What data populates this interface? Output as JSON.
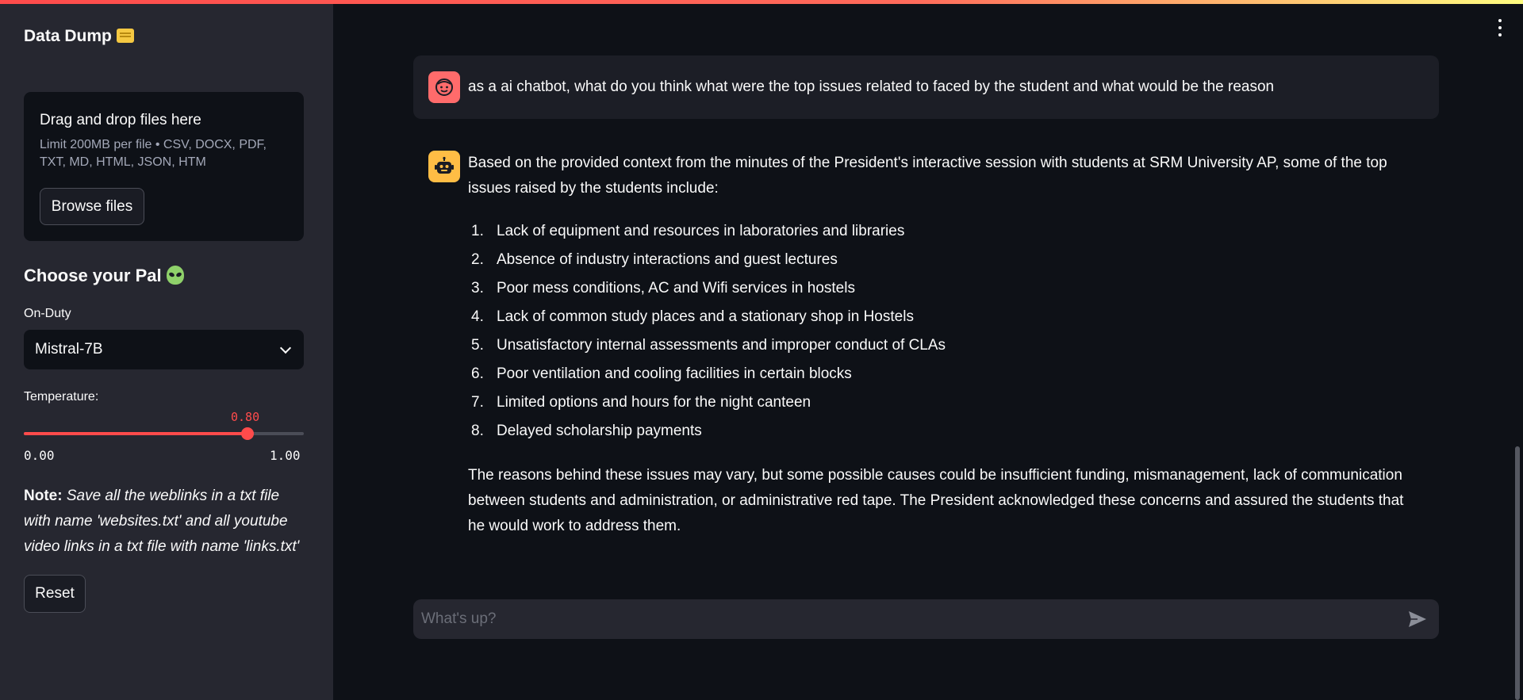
{
  "sidebar": {
    "app_title": "Data Dump",
    "uploader": {
      "title": "Drag and drop files here",
      "limit": "Limit 200MB per file • CSV, DOCX, PDF, TXT, MD, HTML, JSON, HTM",
      "browse_label": "Browse files"
    },
    "pal_title": "Choose your Pal",
    "model_select": {
      "label": "On-Duty",
      "value": "Mistral-7B"
    },
    "temperature": {
      "label": "Temperature:",
      "value": "0.80",
      "level": 0.8,
      "min": "0.00",
      "max": "1.00"
    },
    "note": {
      "label": "Note:",
      "text": "Save all the weblinks in a txt file with name 'websites.txt' and all youtube video links in a txt file with name 'links.txt'"
    },
    "reset_label": "Reset"
  },
  "chat": {
    "user_message": "as a ai chatbot, what do you think what were the top issues related to faced by the student and what would be the reason",
    "assistant": {
      "intro": "Based on the provided context from the minutes of the President's interactive session with students at SRM University AP, some of the top issues raised by the students include:",
      "items": [
        {
          "num": "1.",
          "text": "Lack of equipment and resources in laboratories and libraries"
        },
        {
          "num": "2.",
          "text": "Absence of industry interactions and guest lectures"
        },
        {
          "num": "3.",
          "text": "Poor mess conditions, AC and Wifi services in hostels"
        },
        {
          "num": "4.",
          "text": "Lack of common study places and a stationary shop in Hostels"
        },
        {
          "num": "5.",
          "text": "Unsatisfactory internal assessments and improper conduct of CLAs"
        },
        {
          "num": "6.",
          "text": "Poor ventilation and cooling facilities in certain blocks"
        },
        {
          "num": "7.",
          "text": "Limited options and hours for the night canteen"
        },
        {
          "num": "8.",
          "text": "Delayed scholarship payments"
        }
      ],
      "conclusion": "The reasons behind these issues may vary, but some possible causes could be insufficient funding, mismanagement, lack of communication between students and administration, or administrative red tape. The President acknowledged these concerns and assured the students that he would work to address them."
    },
    "input_placeholder": "What's up?"
  },
  "colors": {
    "accent": "#ff4b4b",
    "sidebar_bg": "#262730",
    "main_bg": "#0e1117",
    "user_avatar": "#ff6b6b",
    "bot_avatar": "#ffbd45"
  },
  "icons": {
    "user_avatar": "face-icon",
    "bot_avatar": "robot-icon",
    "send": "send-icon",
    "menu": "kebab-menu-icon",
    "title_emoji": "card-index-icon",
    "pal_emoji": "alien-icon"
  }
}
